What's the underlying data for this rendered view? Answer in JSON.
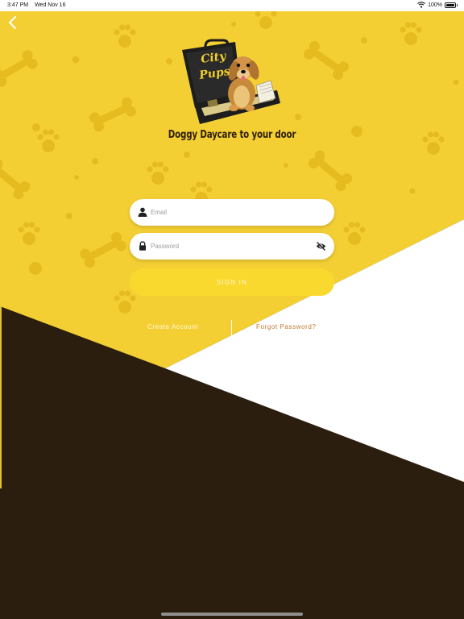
{
  "status_bar": {
    "time": "3:47 PM",
    "date": "Wed Nov 16",
    "battery": "100%"
  },
  "brand": {
    "logo_line1": "City",
    "logo_line2": "Pups",
    "tagline": "Doggy Daycare to your door"
  },
  "form": {
    "email_placeholder": "Email",
    "password_placeholder": "Password",
    "signin_label": "SIGN IN"
  },
  "links": {
    "create_account": "Create Account",
    "forgot_password": "Forgot Password?"
  },
  "colors": {
    "yellow": "#f4cf33",
    "pattern": "#e6bb20",
    "dark_brown": "#2c1e0e",
    "white": "#ffffff",
    "accent": "#c0762b",
    "signin_bg": "#f9d92e"
  }
}
